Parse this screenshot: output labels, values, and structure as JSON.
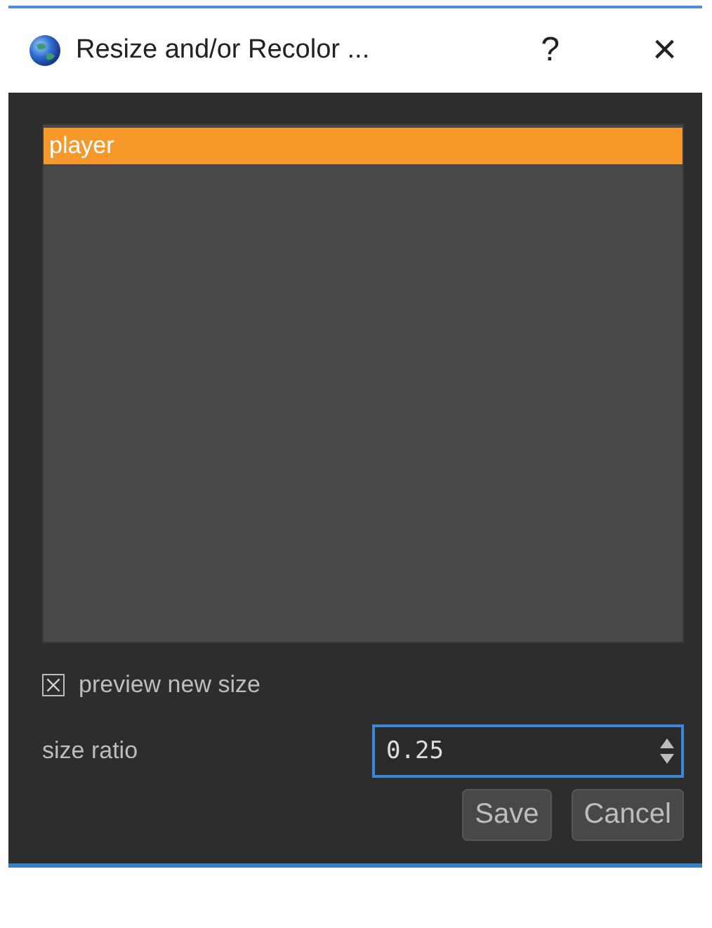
{
  "window": {
    "title": "Resize and/or Recolor ...",
    "help": "?",
    "close": "×"
  },
  "list": {
    "items": [
      {
        "label": "player",
        "selected": true
      }
    ]
  },
  "preview": {
    "label": "preview new size",
    "checked": true
  },
  "size_ratio": {
    "label": "size ratio",
    "value": "0.25"
  },
  "buttons": [
    "Save",
    "Cancel"
  ]
}
